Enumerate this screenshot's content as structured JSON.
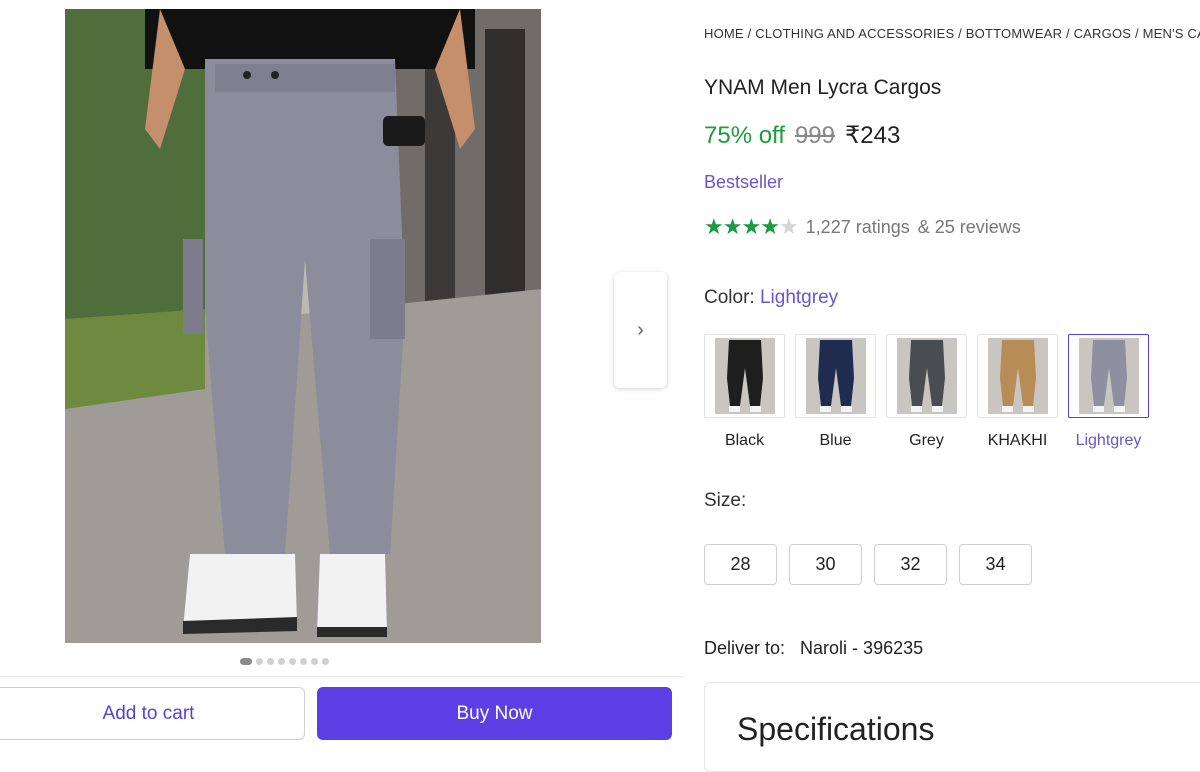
{
  "breadcrumb": "HOME / CLOTHING AND ACCESSORIES / BOTTOMWEAR / CARGOS / MEN'S CARGOS",
  "product": {
    "title": "YNAM Men Lycra Cargos",
    "discount": "75% off",
    "mrp": "999",
    "price": "₹243",
    "badge": "Bestseller",
    "rating_stars": 4,
    "ratings_text": "1,227 ratings",
    "reviews_text": "& 25 reviews"
  },
  "color": {
    "label": "Color:",
    "selected": "Lightgrey",
    "options": [
      {
        "name": "Black",
        "pant": "#1e1e1e"
      },
      {
        "name": "Blue",
        "pant": "#1f2c4f"
      },
      {
        "name": "Grey",
        "pant": "#4a4d50"
      },
      {
        "name": "KHAKHI",
        "pant": "#b78c56"
      },
      {
        "name": "Lightgrey",
        "pant": "#8f8fa2"
      }
    ]
  },
  "size": {
    "label": "Size:",
    "options": [
      "28",
      "30",
      "32",
      "34"
    ]
  },
  "delivery": {
    "label": "Deliver to:",
    "location": "Naroli - 396235"
  },
  "specifications": {
    "title": "Specifications"
  },
  "actions": {
    "add_to_cart": "Add to cart",
    "buy_now": "Buy Now"
  },
  "carousel": {
    "count": 8,
    "active_index": 0
  },
  "colors": {
    "accent": "#5b3fe4",
    "green": "#1f9a3e",
    "purple_text": "#6b55c9"
  },
  "icons": {
    "next": "chevron-right-icon"
  }
}
